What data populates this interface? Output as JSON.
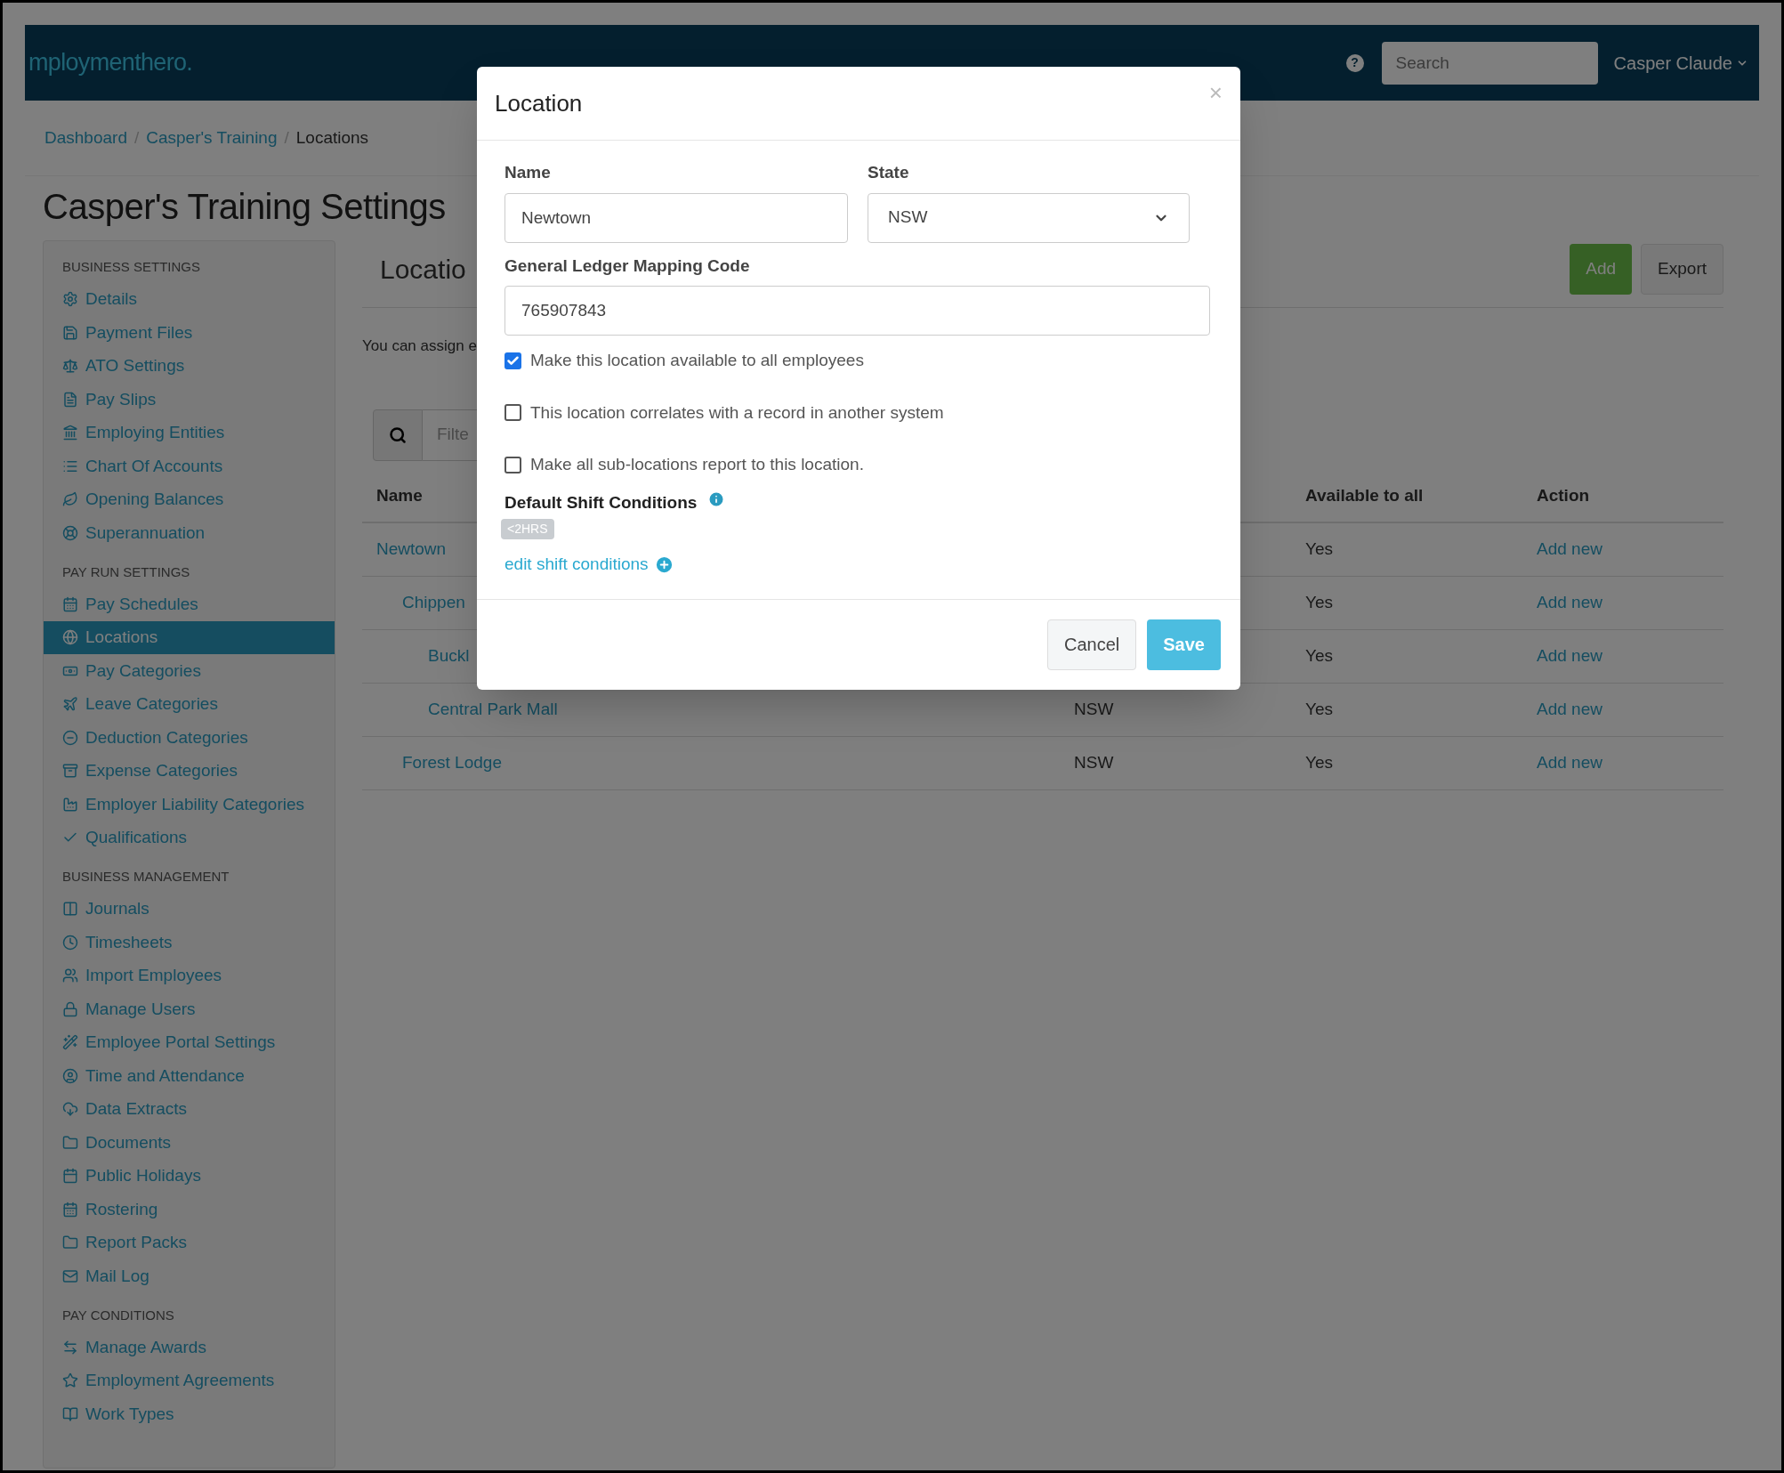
{
  "header": {
    "logo": "mploymenthero.",
    "help": "?",
    "search": {
      "placeholder": "Search"
    },
    "user": "Casper Claude"
  },
  "breadcrumbs": [
    {
      "label": "Dashboard",
      "link": true,
      "separator": "/"
    },
    {
      "label": "Casper's Training",
      "link": true,
      "separator": "/"
    },
    {
      "label": "Locations",
      "link": false
    }
  ],
  "page_title": "Casper's Training Settings",
  "sidebar": {
    "sections": [
      {
        "heading": "BUSINESS SETTINGS",
        "items": [
          {
            "label": "Details",
            "selected": false
          },
          {
            "label": "Payment Files",
            "selected": false
          },
          {
            "label": "ATO Settings",
            "selected": false
          },
          {
            "label": "Pay Slips",
            "selected": false
          },
          {
            "label": "Employing Entities",
            "selected": false
          },
          {
            "label": "Chart Of Accounts",
            "selected": false
          },
          {
            "label": "Opening Balances",
            "selected": false
          },
          {
            "label": "Superannuation",
            "selected": false
          }
        ]
      },
      {
        "heading": "PAY RUN SETTINGS",
        "items": [
          {
            "label": "Pay Schedules",
            "selected": false
          },
          {
            "label": "Locations",
            "selected": true
          },
          {
            "label": "Pay Categories",
            "selected": false
          },
          {
            "label": "Leave Categories",
            "selected": false
          },
          {
            "label": "Deduction Categories",
            "selected": false
          },
          {
            "label": "Expense Categories",
            "selected": false
          },
          {
            "label": "Employer Liability Categories",
            "selected": false
          },
          {
            "label": "Qualifications",
            "selected": false
          }
        ]
      },
      {
        "heading": "BUSINESS MANAGEMENT",
        "items": [
          {
            "label": "Journals",
            "selected": false
          },
          {
            "label": "Timesheets",
            "selected": false
          },
          {
            "label": "Import Employees",
            "selected": false
          },
          {
            "label": "Manage Users",
            "selected": false
          },
          {
            "label": "Employee Portal Settings",
            "selected": false
          },
          {
            "label": "Time and Attendance",
            "selected": false
          },
          {
            "label": "Data Extracts",
            "selected": false
          },
          {
            "label": "Documents",
            "selected": false
          },
          {
            "label": "Public Holidays",
            "selected": false
          },
          {
            "label": "Rostering",
            "selected": false
          },
          {
            "label": "Report Packs",
            "selected": false
          },
          {
            "label": "Mail Log",
            "selected": false
          }
        ]
      },
      {
        "heading": "PAY CONDITIONS",
        "items": [
          {
            "label": "Manage Awards",
            "selected": false
          },
          {
            "label": "Employment Agreements",
            "selected": false
          },
          {
            "label": "Work Types",
            "selected": false
          }
        ]
      }
    ]
  },
  "content": {
    "heading": "Locatio",
    "buttons": [
      {
        "label": "Add",
        "kind": "primary"
      },
      {
        "label": "Export",
        "kind": "default"
      }
    ],
    "intro": "You can assign e",
    "filter": {
      "placeholder": "Filte"
    },
    "table": {
      "columns": [
        "Name",
        "Available to all",
        "Action"
      ],
      "rows": [
        {
          "name": "Newtown",
          "available": "Yes",
          "action": "Add new",
          "children": [
            {
              "name": "Chippen",
              "available": "Yes",
              "action": "Add new",
              "children": [
                {
                  "name": "Buckl",
                  "available": "Yes",
                  "action": "Add new"
                },
                {
                  "name": "Central Park Mall",
                  "state": "NSW",
                  "available": "Yes",
                  "action": "Add new"
                }
              ]
            },
            {
              "name": "Forest Lodge",
              "state": "NSW",
              "available": "Yes",
              "action": "Add new"
            }
          ]
        }
      ]
    }
  },
  "modal": {
    "title": "Location",
    "close": "×",
    "name": {
      "label": "Name",
      "value": "Newtown"
    },
    "state": {
      "label": "State",
      "value": "NSW"
    },
    "gl_code": {
      "label": "General Ledger Mapping Code",
      "value": "765907843"
    },
    "checkboxes": [
      {
        "label": "Make this location available to all employees",
        "checked": true
      },
      {
        "label": "This location correlates with a record in another system",
        "checked": false
      },
      {
        "label": "Make all sub-locations report to this location.",
        "checked": false
      }
    ],
    "shift_conditions": {
      "label": "Default Shift Conditions",
      "tags": [
        "<2HRS"
      ],
      "edit_link": "edit shift conditions"
    },
    "buttons": [
      {
        "label": "Cancel",
        "kind": "default"
      },
      {
        "label": "Save",
        "kind": "primary"
      }
    ]
  }
}
